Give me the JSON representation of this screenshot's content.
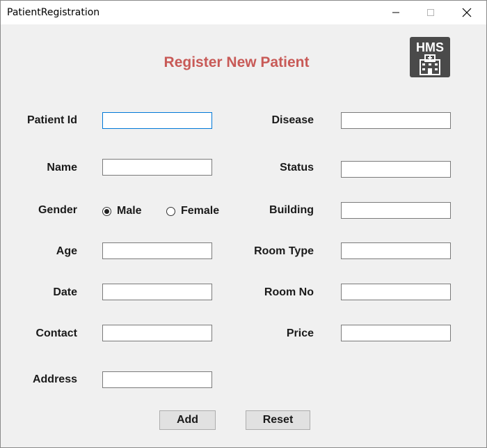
{
  "window": {
    "title": "PatientRegistration"
  },
  "heading": "Register New Patient",
  "logo": {
    "text": "HMS",
    "icon": "hospital-icon"
  },
  "left_labels": {
    "patient_id": "Patient Id",
    "name": "Name",
    "gender": "Gender",
    "age": "Age",
    "date": "Date",
    "contact": "Contact",
    "address": "Address"
  },
  "right_labels": {
    "disease": "Disease",
    "status": "Status",
    "building": "Building",
    "room_type": "Room Type",
    "room_no": "Room No",
    "price": "Price"
  },
  "gender": {
    "options": [
      "Male",
      "Female"
    ],
    "selected": "Male"
  },
  "fields": {
    "patient_id": "",
    "name": "",
    "age": "",
    "date": "",
    "contact": "",
    "address": "",
    "disease": "",
    "status": "",
    "building": "",
    "room_type": "",
    "room_no": "",
    "price": ""
  },
  "buttons": {
    "add": "Add",
    "reset": "Reset"
  },
  "colors": {
    "heading": "#c85a57",
    "focus_border": "#0078d7",
    "logo_bg": "#4a4a4a"
  }
}
